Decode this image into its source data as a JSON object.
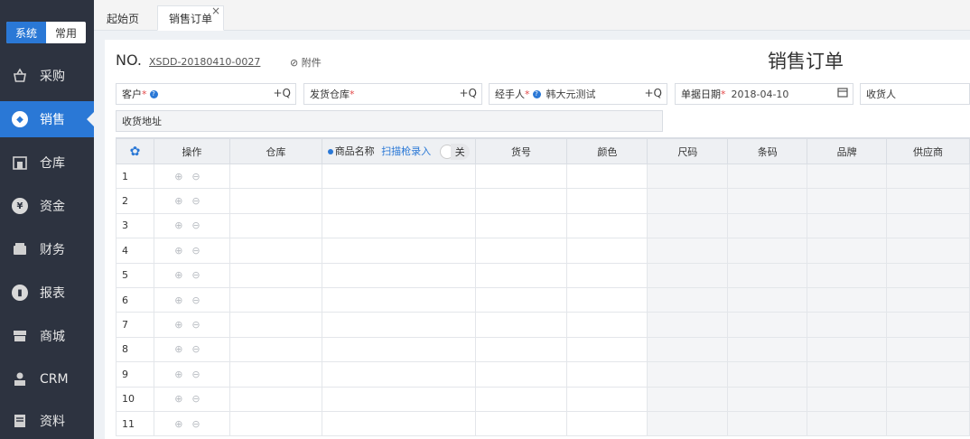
{
  "sidebar": {
    "mode": {
      "system": "系统",
      "common": "常用"
    },
    "items": [
      {
        "label": "采购",
        "icon": "purchase-icon"
      },
      {
        "label": "销售",
        "icon": "sales-icon",
        "active": true
      },
      {
        "label": "仓库",
        "icon": "warehouse-icon"
      },
      {
        "label": "资金",
        "icon": "funds-icon"
      },
      {
        "label": "财务",
        "icon": "finance-icon"
      },
      {
        "label": "报表",
        "icon": "report-icon"
      },
      {
        "label": "商城",
        "icon": "mall-icon"
      },
      {
        "label": "CRM",
        "icon": "crm-icon"
      },
      {
        "label": "资料",
        "icon": "data-icon"
      }
    ]
  },
  "tabs": [
    {
      "label": "起始页"
    },
    {
      "label": "销售订单",
      "active": true,
      "close": "×"
    }
  ],
  "doc": {
    "no_label": "NO.",
    "code": "XSDD-20180410-0027",
    "attachment": "附件",
    "title": "销售订单"
  },
  "form": {
    "customer": {
      "label": "客户",
      "req": "*",
      "tools": "+Q"
    },
    "warehouse": {
      "label": "发货仓库",
      "req": "*",
      "tools": "+Q"
    },
    "handler": {
      "label": "经手人",
      "req": "*",
      "value": "韩大元测试",
      "tools": "+Q"
    },
    "date": {
      "label": "单据日期",
      "req": "*",
      "value": "2018-04-10"
    },
    "receiver": {
      "label": "收货人"
    },
    "address": {
      "label": "收货地址"
    }
  },
  "grid": {
    "columns": [
      "操作",
      "仓库",
      "商品名称",
      "货号",
      "颜色",
      "尺码",
      "条码",
      "品牌",
      "供应商"
    ],
    "scan_label": "扫描枪录入",
    "switch_label": "关",
    "rows": [
      "1",
      "2",
      "3",
      "4",
      "5",
      "6",
      "7",
      "8",
      "9",
      "10",
      "11"
    ],
    "row_ops": "⊕⊖"
  },
  "colors": {
    "accent": "#2a78d6",
    "sidebar": "#2d3340",
    "required": "#e34a4a"
  }
}
